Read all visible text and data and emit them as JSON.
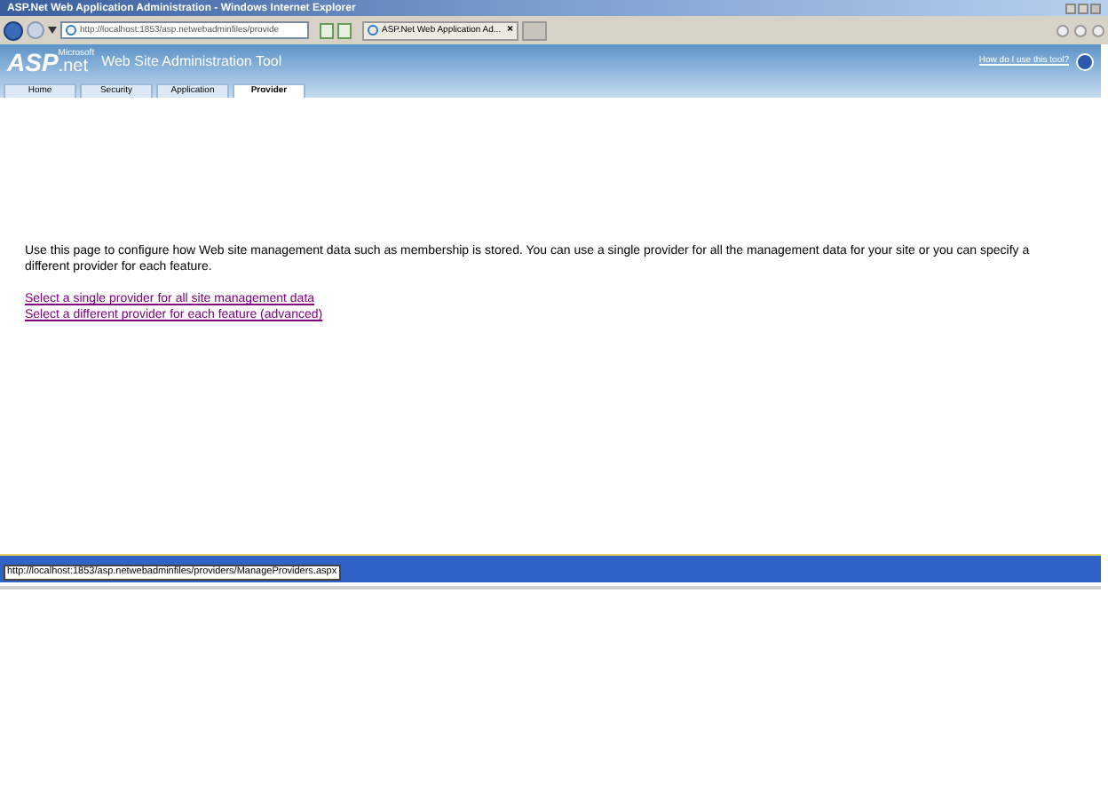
{
  "window": {
    "title": "ASP.Net Web Application Administration - Windows Internet Explorer"
  },
  "browser": {
    "address": "http://localhost:1853/asp.netwebadminfiles/provide",
    "tab_title": "ASP.Net Web Application Ad...",
    "tab_close": "×"
  },
  "header": {
    "logo_main": "ASP",
    "logo_sub": ".net",
    "logo_small": "Microsoft",
    "title": "Web Site Administration Tool",
    "help_link": "How do I use this tool?"
  },
  "tabs": [
    {
      "label": "Home",
      "selected": false
    },
    {
      "label": "Security",
      "selected": false
    },
    {
      "label": "Application",
      "selected": false
    },
    {
      "label": "Provider",
      "selected": true
    }
  ],
  "content": {
    "description": "Use this page to configure how Web site management data such as membership is stored. You can use a single provider for all the management data for your site or you can specify a different provider for each feature.",
    "links": [
      "Select a single provider for all site management data",
      "Select a different provider for each feature (advanced)"
    ]
  },
  "status_bar": {
    "tooltip": "http://localhost:1853/asp.netwebadminfiles/providers/ManageProviders.aspx"
  }
}
